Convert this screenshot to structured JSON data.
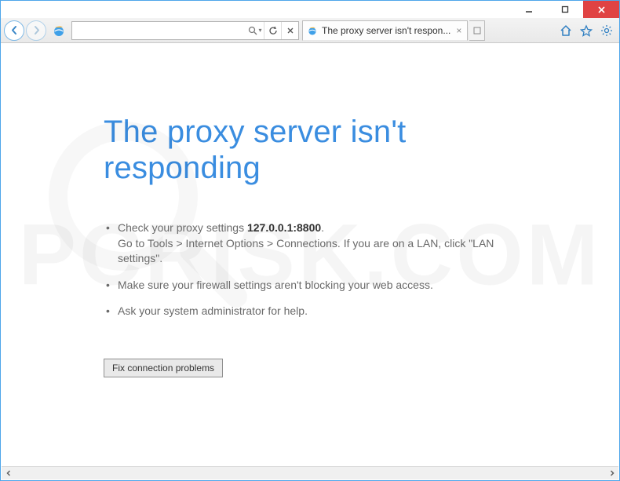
{
  "titlebar": {
    "minimize": "–",
    "maximize": "□",
    "close": "✕"
  },
  "toolbar": {
    "address_value": "",
    "tab_title": "The proxy server isn't respon..."
  },
  "page": {
    "heading": "The proxy server isn't responding",
    "bullet1_prefix": "Check your proxy settings ",
    "bullet1_ip": "127.0.0.1:8800",
    "bullet1_suffix": ".",
    "bullet1_line2": "Go to Tools > Internet Options > Connections. If you are on a LAN, click \"LAN settings\".",
    "bullet2": "Make sure your firewall settings aren't blocking your web access.",
    "bullet3": "Ask your system administrator for help.",
    "fix_button": "Fix connection problems"
  },
  "watermark": "PCRISK.COM"
}
